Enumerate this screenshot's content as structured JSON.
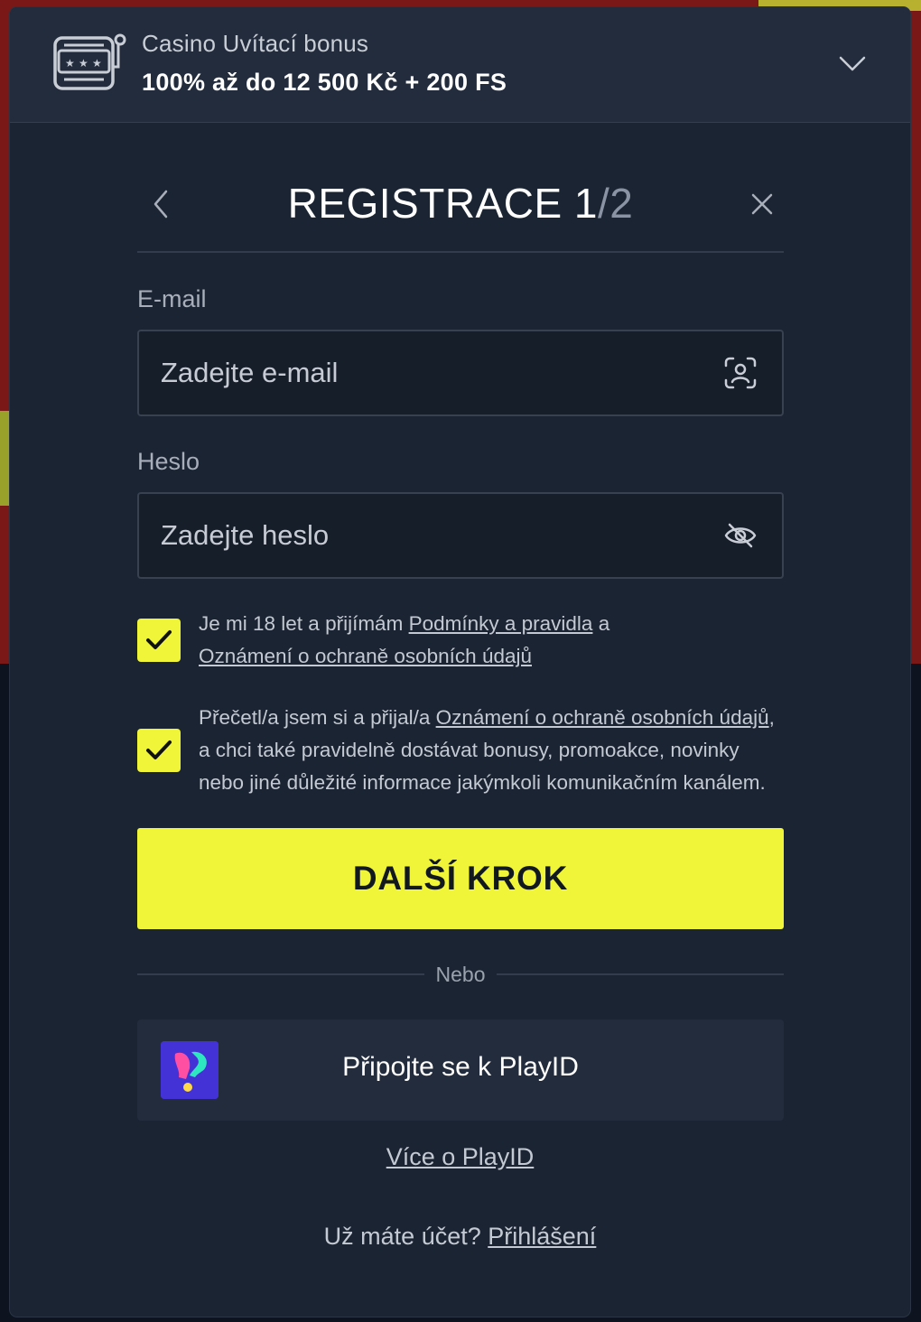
{
  "colors": {
    "accent": "#f0f53a",
    "modal_bg": "#1b2432",
    "input_bg": "#161e2a",
    "banner_bg": "#222c3c"
  },
  "bonus": {
    "subtitle": "Casino Uvítací bonus",
    "offer": "100% až do 12 500 Kč + 200 FS",
    "icon": "slot-machine-icon",
    "toggle_icon": "chevron-down-icon"
  },
  "header": {
    "title_main": "REGISTRACE 1",
    "title_sep_total": "/2",
    "back_icon": "chevron-left-icon",
    "close_icon": "close-icon"
  },
  "form": {
    "email": {
      "label": "E-mail",
      "placeholder": "Zadejte e-mail",
      "value": "",
      "icon": "face-id-icon"
    },
    "password": {
      "label": "Heslo",
      "placeholder": "Zadejte heslo",
      "value": "",
      "icon": "eye-slash-icon"
    }
  },
  "consents": [
    {
      "checked": true,
      "text_before": "Je mi 18 let a přijímám ",
      "link1": "Podmínky a pravidla",
      "text_mid": " a ",
      "link2": "Oznámení o ochraně osobních údajů",
      "text_after": ""
    },
    {
      "checked": true,
      "text_before": "Přečetl/a jsem si a přijal/a ",
      "link1": "Oznámení o ochraně osobních údajů",
      "text_after": ", a chci také pravidelně dostávat bonusy, promoakce, novinky nebo jiné důležité informace jakýmkoli komunikačním kanálem."
    }
  ],
  "actions": {
    "next_label": "DALŠÍ KROK",
    "divider": "Nebo",
    "playid_label": "Připojte se k PlayID",
    "playid_logo": "playid-logo-icon",
    "more_playid": "Více o PlayID",
    "login_prompt": "Už máte účet? ",
    "login_link": "Přihlášení"
  }
}
